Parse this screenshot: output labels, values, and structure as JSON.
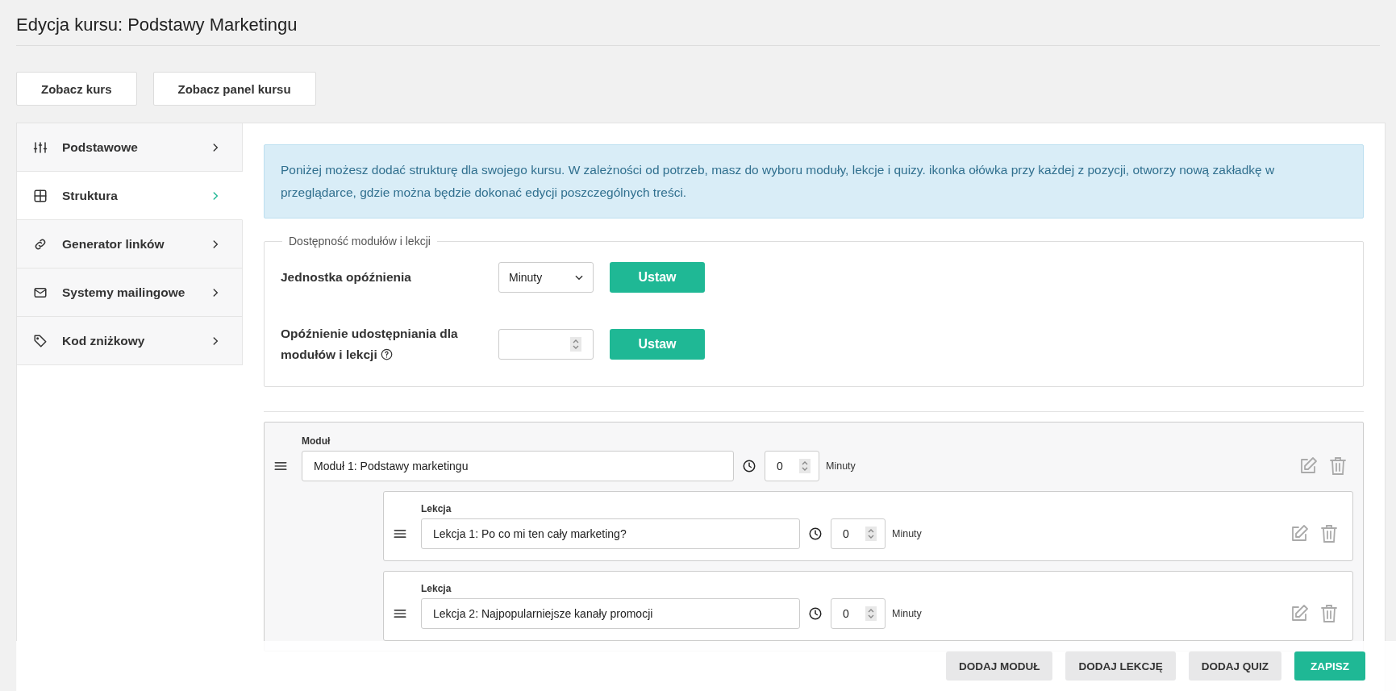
{
  "page": {
    "title": "Edycja kursu: Podstawy Marketingu"
  },
  "top_buttons": [
    {
      "label": "Zobacz kurs"
    },
    {
      "label": "Zobacz panel kursu"
    }
  ],
  "sidebar": {
    "items": [
      {
        "label": "Podstawowe",
        "kind": "sliders",
        "selected": false
      },
      {
        "label": "Struktura",
        "kind": "grid",
        "selected": true
      },
      {
        "label": "Generator linków",
        "kind": "link",
        "selected": false
      },
      {
        "label": "Systemy mailingowe",
        "kind": "mail",
        "selected": false
      },
      {
        "label": "Kod zniżkowy",
        "kind": "tag",
        "selected": false
      }
    ]
  },
  "info": "Poniżej możesz dodać strukturę dla swojego kursu. W zależności od potrzeb, masz do wyboru moduły, lekcje i quizy. ikonka ołówka przy każdej z pozycji, otworzy nową zakładkę w przeglądarce, gdzie można będzie dokonać edycji poszczególnych treści.",
  "availability": {
    "legend": "Dostępność modułów i lekcji",
    "rows": [
      {
        "kind": "select",
        "label": "Jednostka opóźnienia",
        "value": "Minuty",
        "button": "Ustaw",
        "help": false
      },
      {
        "kind": "number",
        "label": "Opóźnienie udostępniania dla modułów i lekcji",
        "button": "Ustaw",
        "help": true
      }
    ]
  },
  "module": {
    "label": "Moduł",
    "value": "Moduł 1: Podstawy marketingu",
    "delay": "0",
    "unit": "Minuty",
    "lessons": [
      {
        "label": "Lekcja",
        "value": "Lekcja 1: Po co mi ten cały marketing?",
        "delay": "0",
        "unit": "Minuty"
      },
      {
        "label": "Lekcja",
        "value": "Lekcja 2: Najpopularniejsze kanały promocji",
        "delay": "0",
        "unit": "Minuty"
      }
    ]
  },
  "footer_buttons": [
    {
      "label": "DODAJ MODUŁ",
      "kind": "secondary"
    },
    {
      "label": "DODAJ LEKCJĘ",
      "kind": "secondary"
    },
    {
      "label": "DODAJ QUIZ",
      "kind": "secondary"
    },
    {
      "label": "ZAPISZ",
      "kind": "primary"
    }
  ]
}
